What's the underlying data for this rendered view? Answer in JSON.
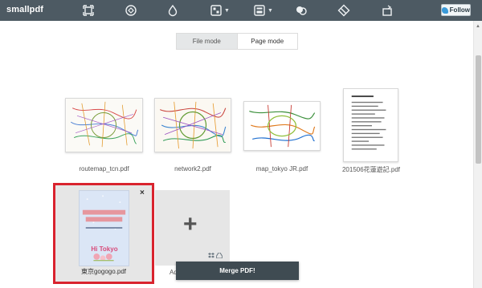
{
  "app": {
    "brand": "smallpdf"
  },
  "toolbar": {
    "tools": [
      {
        "icon": "compress-icon"
      },
      {
        "icon": "convert-icon"
      },
      {
        "icon": "drop-icon"
      },
      {
        "icon": "pdf-to-office-icon",
        "has_menu": true
      },
      {
        "icon": "office-to-pdf-icon",
        "has_menu": true
      },
      {
        "icon": "merge-icon"
      },
      {
        "icon": "split-icon"
      },
      {
        "icon": "rotate-icon"
      }
    ],
    "follow_label": "Follow"
  },
  "mode_toggle": {
    "file_mode": "File mode",
    "page_mode": "Page mode",
    "selected": "File mode"
  },
  "files": [
    {
      "name": "routemap_tcn.pdf",
      "type": "map"
    },
    {
      "name": "network2.pdf",
      "type": "map"
    },
    {
      "name": "map_tokyo JR.pdf",
      "type": "map"
    },
    {
      "name": "201506花蓮遊記.pdf",
      "type": "document"
    }
  ],
  "selected_file": {
    "name": "東京gogogo.pdf",
    "poster_text": "Hi Tokyo",
    "close_glyph": "×"
  },
  "add_card": {
    "plus_glyph": "+",
    "label": "Ad"
  },
  "merge_button": {
    "label": "Merge PDF!"
  },
  "colors": {
    "topbar": "#4d5a63",
    "highlight": "#d9232e",
    "merge": "#3f4b52"
  }
}
